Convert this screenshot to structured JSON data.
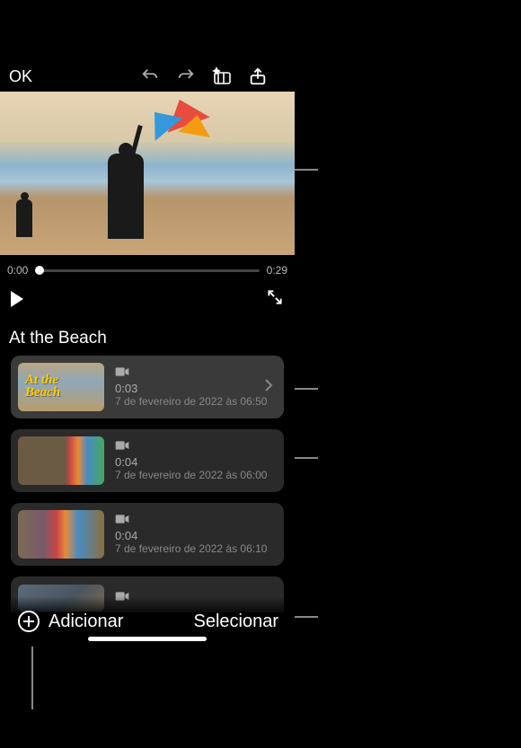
{
  "header": {
    "ok_label": "OK"
  },
  "timeline": {
    "start": "0:00",
    "end": "0:29"
  },
  "project_title": "At the Beach",
  "clips": [
    {
      "title_overlay_line1": "At the",
      "title_overlay_line2": "Beach",
      "duration": "0:03",
      "date": "7 de fevereiro de 2022 às 06:50"
    },
    {
      "duration": "0:04",
      "date": "7 de fevereiro de 2022 às 06:00"
    },
    {
      "duration": "0:04",
      "date": "7 de fevereiro de 2022 às 06:10"
    },
    {
      "duration": "",
      "date": ""
    }
  ],
  "footer": {
    "add_label": "Adicionar",
    "select_label": "Selecionar"
  }
}
